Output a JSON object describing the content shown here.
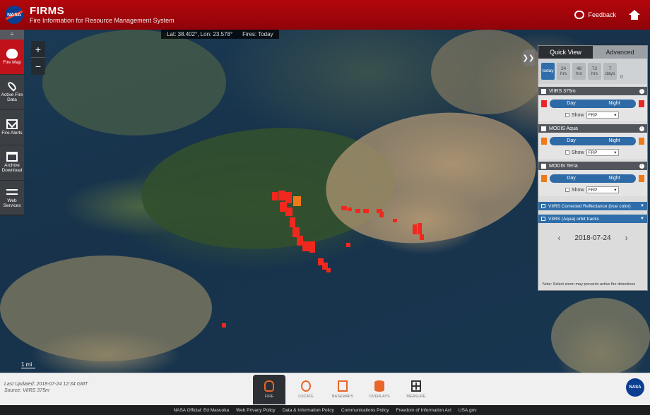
{
  "header": {
    "logo_text": "NASA",
    "title": "FIRMS",
    "subtitle": "Fire Information for Resource Management System",
    "feedback_label": "Feedback"
  },
  "map": {
    "coords_text": "Lat: 38.402°, Lon: 23.578°",
    "fires_text": "Fires: Today",
    "zoom_in": "+",
    "zoom_out": "−",
    "scale_label": "1 mi",
    "collapse_label": "❯❯"
  },
  "left_toolbar": {
    "handle": "≡",
    "items": [
      {
        "label": "Fire Map"
      },
      {
        "label": "Active Fire Data"
      },
      {
        "label": "Fire Alerts"
      },
      {
        "label": "Archive Download"
      },
      {
        "label": "Web Services"
      }
    ]
  },
  "panel": {
    "tabs": [
      "Quick View",
      "Advanced"
    ],
    "ranges": [
      {
        "top": "today",
        "bottom": ""
      },
      {
        "top": "24",
        "bottom": "hrs"
      },
      {
        "top": "48",
        "bottom": "hrs"
      },
      {
        "top": "72",
        "bottom": "hrs"
      },
      {
        "top": "7",
        "bottom": "days"
      }
    ],
    "range_info": "0",
    "layers": [
      {
        "name": "VIIRS 375m",
        "color": "#e8262a",
        "day": "Day",
        "night": "Night",
        "show": "Show",
        "select": "FRP"
      },
      {
        "name": "MODIS Aqua",
        "color": "#f07a18",
        "day": "Day",
        "night": "Night",
        "show": "Show",
        "select": "FRP"
      },
      {
        "name": "MODIS Terra",
        "color": "#f07a18",
        "day": "Day",
        "night": "Night",
        "show": "Show",
        "select": "FRP"
      }
    ],
    "extra_layers": [
      {
        "name": "VIIRS Corrected Reflectance (true color)"
      },
      {
        "name": "VIIRS (Aqua) orbit tracks"
      }
    ],
    "date": "2018-07-24",
    "note": "Note: Select zoom may prevents active fire detections"
  },
  "bottom": {
    "last_updated": "Last Updated: 2018-07-24 12:34 GMT",
    "source": "Source: VIIRS 375m",
    "nav": [
      {
        "label": "FIRE"
      },
      {
        "label": "LOCATE"
      },
      {
        "label": "BASEMAPS"
      },
      {
        "label": "OVERLAYS"
      },
      {
        "label": "MEASURE"
      }
    ]
  },
  "footer": {
    "links": [
      "NASA Official: Ed Masuoka",
      "Web Privacy Policy",
      "Data & Information Policy",
      "Communications Policy",
      "Freedom of Information Act",
      "USA.gov"
    ]
  }
}
